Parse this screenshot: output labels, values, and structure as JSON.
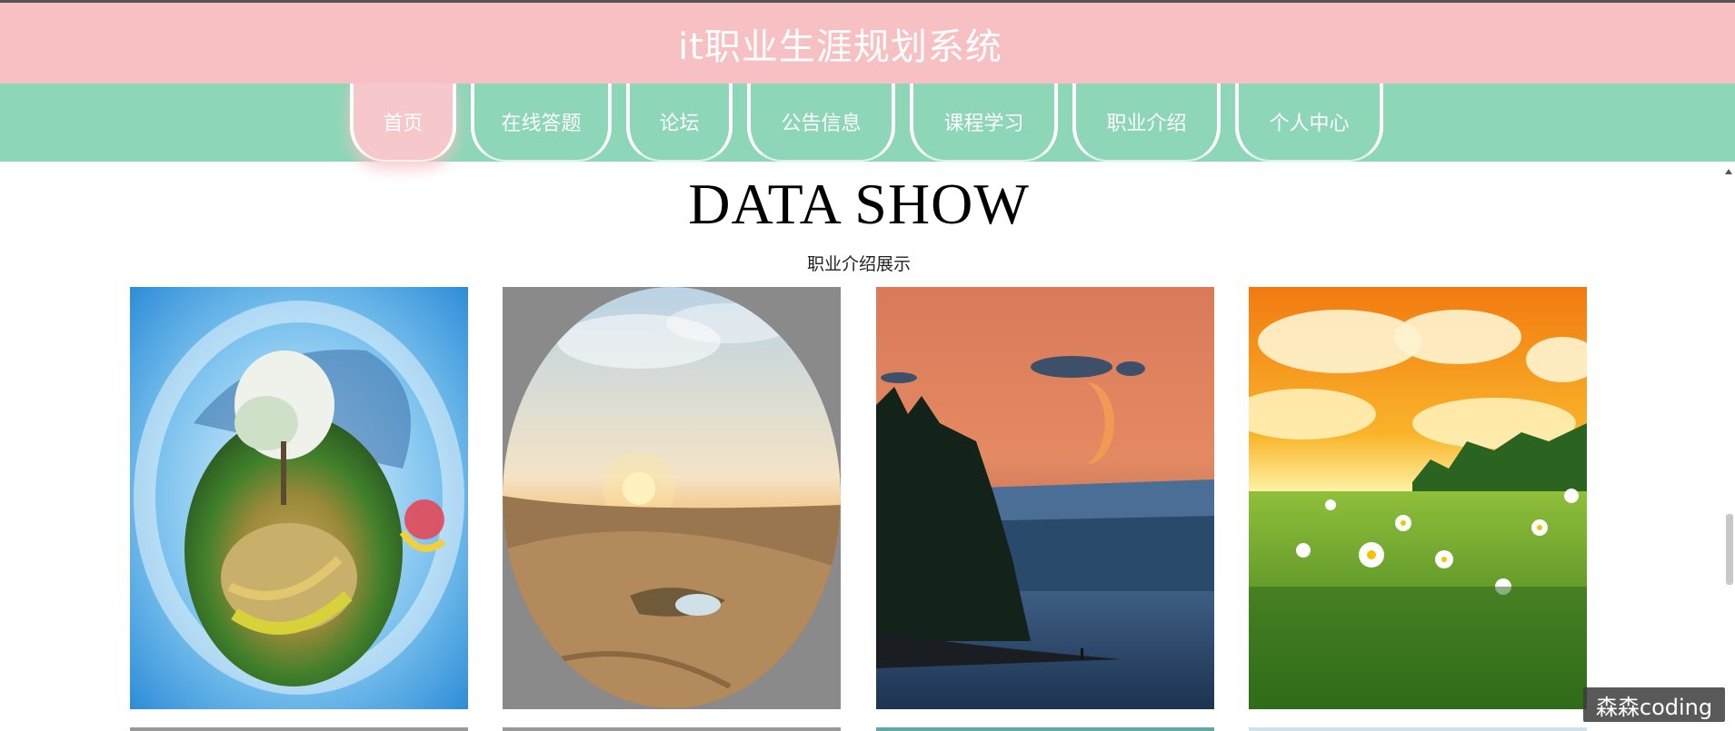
{
  "header": {
    "title": "it职业生涯规划系统"
  },
  "nav": {
    "items": [
      {
        "label": "首页"
      },
      {
        "label": "在线答题"
      },
      {
        "label": "论坛"
      },
      {
        "label": "公告信息"
      },
      {
        "label": "课程学习"
      },
      {
        "label": "职业介绍"
      },
      {
        "label": "个人中心"
      }
    ],
    "active_index": 0
  },
  "section": {
    "title": "DATA SHOW",
    "subtitle": "职业介绍展示"
  },
  "gallery": {
    "items": [
      {
        "image": "tiny-planet-landscape"
      },
      {
        "image": "desert-oasis-sunset"
      },
      {
        "image": "lake-moon-dusk"
      },
      {
        "image": "meadow-sunset-daisies"
      }
    ]
  },
  "watermark": "森森coding",
  "colors": {
    "header_bg": "#f7c1c4",
    "nav_bg": "#8dd7b8",
    "active_tab_bg": "#f6c8cb"
  }
}
